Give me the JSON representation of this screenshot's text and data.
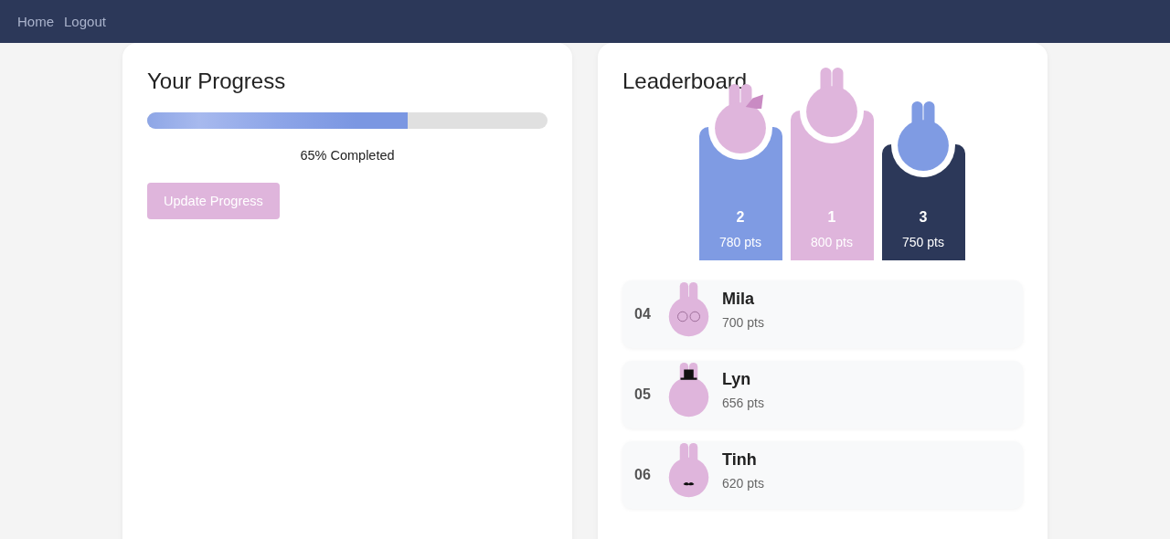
{
  "nav": {
    "links": [
      "Home",
      "Logout"
    ]
  },
  "progress": {
    "title": "Your Progress",
    "level": 0.65,
    "reading": "65% Completed",
    "button": "Update Progress"
  },
  "leaderboard": {
    "title": "Leaderboard",
    "podium": [
      {
        "rank": "2",
        "points": "780 pts",
        "color": "#7f9be3"
      },
      {
        "rank": "1",
        "points": "800 pts",
        "color": "#dfb5dc"
      },
      {
        "rank": "3",
        "points": "750 pts",
        "color": "#2c3859"
      }
    ],
    "rows": [
      {
        "rank": "04",
        "name": "Mila",
        "points": "700 pts"
      },
      {
        "rank": "05",
        "name": "Lyn",
        "points": "656 pts"
      },
      {
        "rank": "06",
        "name": "Tinh",
        "points": "620 pts"
      }
    ]
  }
}
